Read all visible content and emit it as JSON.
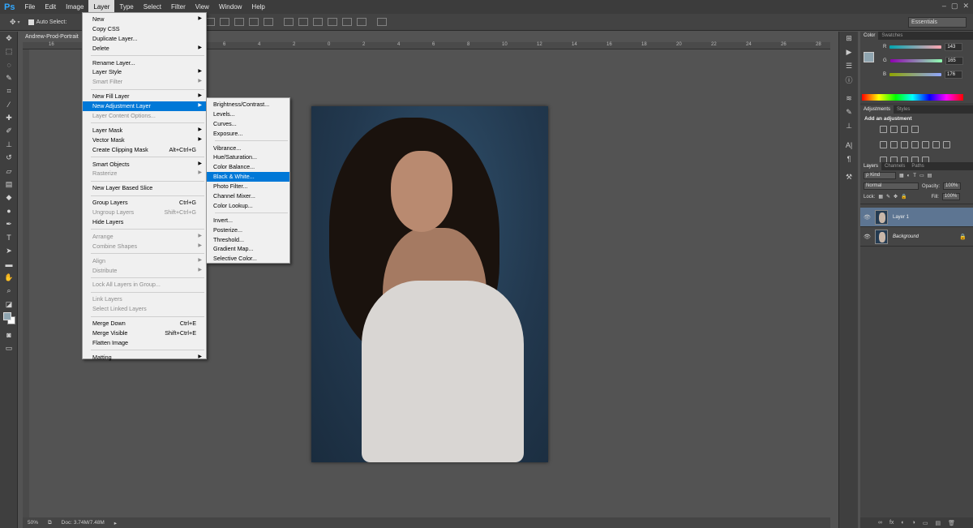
{
  "app": {
    "logo": "Ps"
  },
  "menubar": {
    "items": [
      "File",
      "Edit",
      "Image",
      "Layer",
      "Type",
      "Select",
      "Filter",
      "View",
      "Window",
      "Help"
    ],
    "active": "Layer"
  },
  "window_controls": {
    "minimize": "–",
    "maximize": "▢",
    "close": "✕"
  },
  "options_bar": {
    "auto_select_label": "Auto Select:",
    "workspace": "Essentials"
  },
  "document": {
    "tab_title": "Andrew-Prod-Portrait"
  },
  "ruler": {
    "top_labels": [
      "16",
      "14",
      "12",
      "10",
      "8",
      "6",
      "4",
      "2",
      "0",
      "2",
      "4",
      "6",
      "8",
      "10",
      "12",
      "14",
      "16",
      "18",
      "20",
      "22",
      "24",
      "26",
      "28"
    ]
  },
  "status": {
    "zoom": "50%",
    "doc_info": "Doc: 3.74M/7.48M"
  },
  "layer_menu": {
    "groups": [
      [
        {
          "label": "New",
          "sub": true
        },
        {
          "label": "Copy CSS"
        },
        {
          "label": "Duplicate Layer..."
        },
        {
          "label": "Delete",
          "sub": true
        }
      ],
      [
        {
          "label": "Rename Layer..."
        },
        {
          "label": "Layer Style",
          "sub": true
        },
        {
          "label": "Smart Filter",
          "disabled": true,
          "sub": true
        }
      ],
      [
        {
          "label": "New Fill Layer",
          "sub": true
        },
        {
          "label": "New Adjustment Layer",
          "sub": true,
          "highlight": true
        },
        {
          "label": "Layer Content Options...",
          "disabled": true
        }
      ],
      [
        {
          "label": "Layer Mask",
          "sub": true
        },
        {
          "label": "Vector Mask",
          "sub": true
        },
        {
          "label": "Create Clipping Mask",
          "shortcut": "Alt+Ctrl+G"
        }
      ],
      [
        {
          "label": "Smart Objects",
          "sub": true
        },
        {
          "label": "Rasterize",
          "disabled": true,
          "sub": true
        }
      ],
      [
        {
          "label": "New Layer Based Slice"
        }
      ],
      [
        {
          "label": "Group Layers",
          "shortcut": "Ctrl+G"
        },
        {
          "label": "Ungroup Layers",
          "shortcut": "Shift+Ctrl+G",
          "disabled": true
        },
        {
          "label": "Hide Layers"
        }
      ],
      [
        {
          "label": "Arrange",
          "disabled": true,
          "sub": true
        },
        {
          "label": "Combine Shapes",
          "disabled": true,
          "sub": true
        }
      ],
      [
        {
          "label": "Align",
          "disabled": true,
          "sub": true
        },
        {
          "label": "Distribute",
          "disabled": true,
          "sub": true
        }
      ],
      [
        {
          "label": "Lock All Layers in Group...",
          "disabled": true
        }
      ],
      [
        {
          "label": "Link Layers",
          "disabled": true
        },
        {
          "label": "Select Linked Layers",
          "disabled": true
        }
      ],
      [
        {
          "label": "Merge Down",
          "shortcut": "Ctrl+E"
        },
        {
          "label": "Merge Visible",
          "shortcut": "Shift+Ctrl+E"
        },
        {
          "label": "Flatten Image"
        }
      ],
      [
        {
          "label": "Matting",
          "sub": true
        }
      ]
    ]
  },
  "adjustment_submenu": {
    "groups": [
      [
        {
          "label": "Brightness/Contrast..."
        },
        {
          "label": "Levels..."
        },
        {
          "label": "Curves..."
        },
        {
          "label": "Exposure..."
        }
      ],
      [
        {
          "label": "Vibrance..."
        },
        {
          "label": "Hue/Saturation..."
        },
        {
          "label": "Color Balance..."
        },
        {
          "label": "Black & White...",
          "highlight": true
        },
        {
          "label": "Photo Filter..."
        },
        {
          "label": "Channel Mixer..."
        },
        {
          "label": "Color Lookup..."
        }
      ],
      [
        {
          "label": "Invert..."
        },
        {
          "label": "Posterize..."
        },
        {
          "label": "Threshold..."
        },
        {
          "label": "Gradient Map..."
        },
        {
          "label": "Selective Color..."
        }
      ]
    ]
  },
  "color_panel": {
    "tabs": [
      "Color",
      "Swatches"
    ],
    "r_label": "R",
    "r": "143",
    "g_label": "G",
    "g": "165",
    "b_label": "B",
    "b": "176",
    "foreground_hex": "#8fa5b0"
  },
  "adjustments_panel": {
    "tabs": [
      "Adjustments",
      "Styles"
    ],
    "title": "Add an adjustment"
  },
  "layers_panel": {
    "tabs": [
      "Layers",
      "Channels",
      "Paths"
    ],
    "kind_filter": "ρ Kind",
    "blend_mode": "Normal",
    "opacity_label": "Opacity:",
    "opacity": "100%",
    "lock_label": "Lock:",
    "fill_label": "Fill:",
    "fill": "100%",
    "layers": [
      {
        "name": "Layer 1",
        "selected": true
      },
      {
        "name": "Background",
        "locked": true
      }
    ],
    "footer_icons": [
      "∞",
      "fx",
      "◐",
      "◑",
      "▭",
      "▤",
      "🗑"
    ]
  },
  "colors": {
    "menu_highlight": "#0078d7",
    "selected_layer": "#5d7592",
    "ps_blue": "#31a8ff"
  }
}
